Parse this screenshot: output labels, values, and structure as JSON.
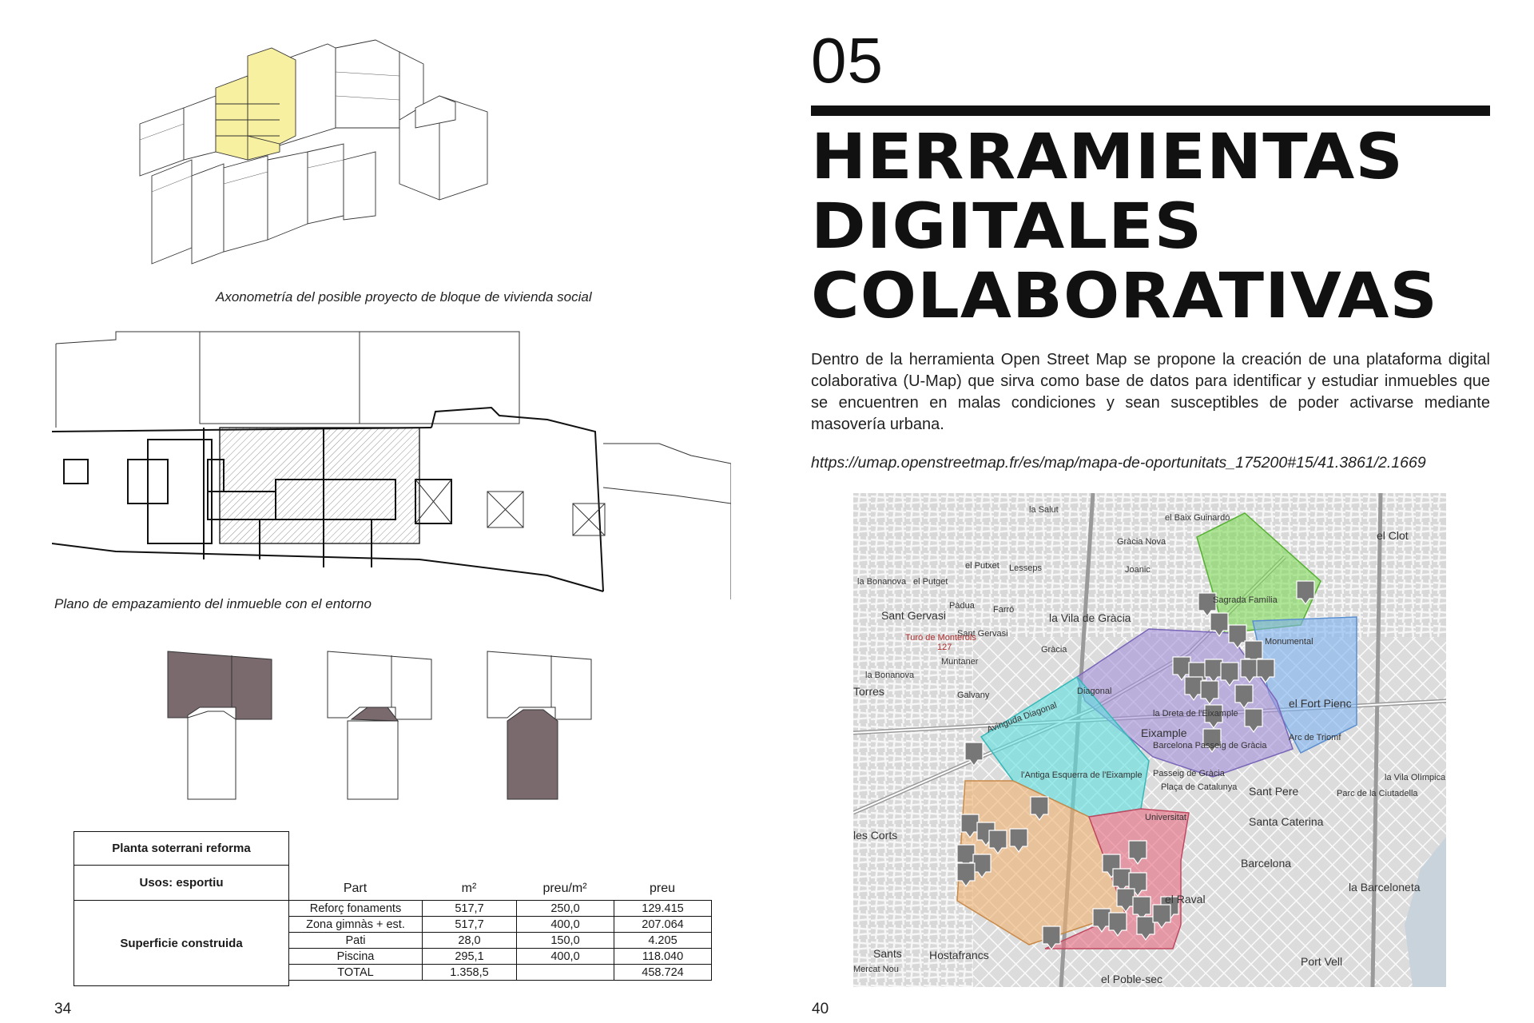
{
  "left_page": {
    "axonometry_caption": "Axonometría del posible proyecto de bloque de vivienda social",
    "siteplan_caption": "Plano de empazamiento del inmueble con el entorno",
    "page_number": "34",
    "colors": {
      "highlight_yellow": "#f7f0a0",
      "basement_fill": "#7a6a6e"
    },
    "table": {
      "title": "Planta soterrani reforma",
      "uses": "Usos: esportiu",
      "group_label": "Superficie  construida",
      "headers": [
        "Part",
        "m²",
        "preu/m²",
        "preu"
      ],
      "rows": [
        [
          "Reforç fonaments",
          "517,7",
          "250,0",
          "129.415"
        ],
        [
          "Zona gimnàs + est.",
          "517,7",
          "400,0",
          "207.064"
        ],
        [
          "Pati",
          "28,0",
          "150,0",
          "4.205"
        ],
        [
          "Piscina",
          "295,1",
          "400,0",
          "118.040"
        ],
        [
          "TOTAL",
          "1.358,5",
          "",
          "458.724"
        ]
      ]
    }
  },
  "right_page": {
    "chapter_number": "05",
    "title_lines": [
      "HERRAMIENTAS",
      "DIGITALES",
      "COLABORATIVAS"
    ],
    "body": "Dentro de la herramienta Open Street Map se propone la creación de una plataforma digital colaborativa (U-Map) que sirva como base de datos para identificar y estudiar inmuebles que se encuentren en malas condiciones y sean susceptibles de poder activarse mediante masovería urbana.",
    "url": "https://umap.openstreetmap.fr/es/map/mapa-de-oportunitats_175200#15/41.3861/2.1669",
    "page_number": "40",
    "map": {
      "labels": [
        "la Salut",
        "el Baix Guinardó",
        "Gràcia Nova",
        "el Putxet",
        "Lesseps",
        "Joanic",
        "Sagrada Família",
        "el Clot",
        "la Bonanova",
        "el Putget",
        "Pàdua",
        "Farró",
        "Sant Gervasi",
        "Sant Gervasi",
        "la Vila de Gràcia",
        "Turó de Monterols",
        "127",
        "Gràcia",
        "Muntaner",
        "Monumental",
        "la Bonanova",
        "Galvany",
        "Diagonal",
        "Torres",
        "Avinguda Diagonal",
        "la Dreta de l'Eixample",
        "el Fort Pienc",
        "Eixample",
        "Barcelona Passeig de Gràcia",
        "Arc de Triomf",
        "l'Antiga Esquerra de l'Eixample",
        "Passeig de Gràcia",
        "Plaça de Catalunya",
        "Sant Pere",
        "Parc de la Ciutadella",
        "la Vila Olímpica",
        "Universitat",
        "Santa Caterina",
        "les Corts",
        "Barcelona",
        "la Barceloneta",
        "el Raval",
        "Hostafrancs",
        "Sants",
        "Port Vell",
        "el Poble-sec",
        "Mercat Nou"
      ],
      "zone_colors": {
        "green": "#7ed957",
        "blue": "#7fb2f0",
        "purple": "#a38fd9",
        "cyan": "#5fe0e0",
        "orange": "#f0b070",
        "red": "#e86a80"
      }
    }
  }
}
